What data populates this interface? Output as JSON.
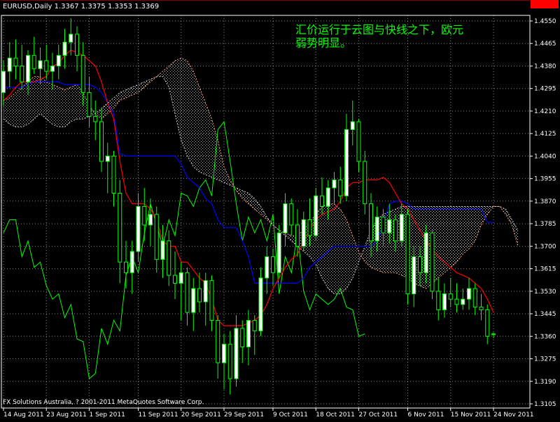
{
  "symbol_header": "EURUSD,Daily  1.3367 1.3375 1.3353 1.3369",
  "annotation": "汇价运行于云图与快线之下，欧元弱势明显。",
  "annotation_lines": [
    "汇价运行于云图与快线之下，欧元",
    "弱势明显。"
  ],
  "copyright": "FX Solutions Australia, ? 2001-2011 MetaQuotes Software Corp.",
  "price_marker": "1.3369",
  "colors": {
    "background": "#000000",
    "grid": "#c0c0c0",
    "candle_outline": "#00ff00",
    "bull_body": "#ffffff",
    "bear_body": "#000000",
    "tenkan": "#ff0000",
    "kijun": "#0000ff",
    "chikou": "#00ff00",
    "cloud_up": "#ffa07a",
    "cloud_down": "#d0d0d0",
    "price_line": "#ff0000",
    "annotation": "#00ff00",
    "text": "#ffffff"
  },
  "chart_data": {
    "type": "candlestick",
    "indicator": "Ichimoku",
    "symbol": "EURUSD",
    "timeframe": "Daily",
    "ohlc_last": {
      "open": 1.3367,
      "high": 1.3375,
      "low": 1.3353,
      "close": 1.3369
    },
    "ylim": [
      1.3105,
      1.455
    ],
    "grid": true,
    "y_ticks": [
      1.455,
      1.4465,
      1.438,
      1.4295,
      1.421,
      1.4125,
      1.404,
      1.3955,
      1.387,
      1.3785,
      1.37,
      1.3615,
      1.353,
      1.3445,
      1.336,
      1.3275,
      1.319,
      1.3105
    ],
    "y_tick_labels": [
      "1.4550",
      "1.4465",
      "1.4380",
      "1.4295",
      "1.4210",
      "1.4125",
      "1.4040",
      "1.3955",
      "1.3870",
      "1.3785",
      "1.3700",
      "1.3615",
      "1.3530",
      "1.3445",
      "1.3360",
      "1.3275",
      "1.3190",
      "1.3105"
    ],
    "x_tick_labels": [
      "14 Aug 2011",
      "23 Aug 2011",
      "1 Sep 2011",
      "11 Sep 2011",
      "20 Sep 2011",
      "29 Sep 2011",
      "9 Oct 2011",
      "18 Oct 2011",
      "27 Oct 2011",
      "6 Nov 2011",
      "15 Nov 2011",
      "24 Nov 2011"
    ],
    "x_tick_bar_index": [
      0,
      7,
      14,
      22,
      29,
      36,
      44,
      51,
      58,
      66,
      73,
      80
    ],
    "bars": [
      {
        "o": 1.428,
        "h": 1.44,
        "l": 1.423,
        "c": 1.436
      },
      {
        "o": 1.436,
        "h": 1.447,
        "l": 1.43,
        "c": 1.441
      },
      {
        "o": 1.441,
        "h": 1.448,
        "l": 1.433,
        "c": 1.438
      },
      {
        "o": 1.438,
        "h": 1.446,
        "l": 1.429,
        "c": 1.432
      },
      {
        "o": 1.432,
        "h": 1.444,
        "l": 1.427,
        "c": 1.442
      },
      {
        "o": 1.442,
        "h": 1.449,
        "l": 1.435,
        "c": 1.437
      },
      {
        "o": 1.437,
        "h": 1.445,
        "l": 1.431,
        "c": 1.44
      },
      {
        "o": 1.44,
        "h": 1.446,
        "l": 1.433,
        "c": 1.436
      },
      {
        "o": 1.436,
        "h": 1.443,
        "l": 1.429,
        "c": 1.438
      },
      {
        "o": 1.438,
        "h": 1.446,
        "l": 1.433,
        "c": 1.442
      },
      {
        "o": 1.442,
        "h": 1.452,
        "l": 1.437,
        "c": 1.447
      },
      {
        "o": 1.447,
        "h": 1.456,
        "l": 1.442,
        "c": 1.45
      },
      {
        "o": 1.45,
        "h": 1.453,
        "l": 1.436,
        "c": 1.442
      },
      {
        "o": 1.442,
        "h": 1.447,
        "l": 1.423,
        "c": 1.428
      },
      {
        "o": 1.428,
        "h": 1.434,
        "l": 1.415,
        "c": 1.419
      },
      {
        "o": 1.419,
        "h": 1.425,
        "l": 1.41,
        "c": 1.417
      },
      {
        "o": 1.417,
        "h": 1.422,
        "l": 1.398,
        "c": 1.402
      },
      {
        "o": 1.402,
        "h": 1.409,
        "l": 1.39,
        "c": 1.404
      },
      {
        "o": 1.404,
        "h": 1.406,
        "l": 1.385,
        "c": 1.39
      },
      {
        "o": 1.39,
        "h": 1.395,
        "l": 1.356,
        "c": 1.364
      },
      {
        "o": 1.364,
        "h": 1.372,
        "l": 1.354,
        "c": 1.36
      },
      {
        "o": 1.36,
        "h": 1.372,
        "l": 1.352,
        "c": 1.368
      },
      {
        "o": 1.368,
        "h": 1.39,
        "l": 1.364,
        "c": 1.385
      },
      {
        "o": 1.385,
        "h": 1.392,
        "l": 1.372,
        "c": 1.378
      },
      {
        "o": 1.378,
        "h": 1.388,
        "l": 1.37,
        "c": 1.382
      },
      {
        "o": 1.382,
        "h": 1.385,
        "l": 1.36,
        "c": 1.365
      },
      {
        "o": 1.365,
        "h": 1.378,
        "l": 1.358,
        "c": 1.372
      },
      {
        "o": 1.372,
        "h": 1.376,
        "l": 1.355,
        "c": 1.359
      },
      {
        "o": 1.359,
        "h": 1.368,
        "l": 1.35,
        "c": 1.356
      },
      {
        "o": 1.356,
        "h": 1.364,
        "l": 1.342,
        "c": 1.36
      },
      {
        "o": 1.36,
        "h": 1.362,
        "l": 1.34,
        "c": 1.345
      },
      {
        "o": 1.345,
        "h": 1.358,
        "l": 1.338,
        "c": 1.354
      },
      {
        "o": 1.354,
        "h": 1.36,
        "l": 1.345,
        "c": 1.349
      },
      {
        "o": 1.349,
        "h": 1.36,
        "l": 1.34,
        "c": 1.357
      },
      {
        "o": 1.357,
        "h": 1.359,
        "l": 1.338,
        "c": 1.342
      },
      {
        "o": 1.342,
        "h": 1.344,
        "l": 1.32,
        "c": 1.326
      },
      {
        "o": 1.326,
        "h": 1.337,
        "l": 1.316,
        "c": 1.333
      },
      {
        "o": 1.333,
        "h": 1.338,
        "l": 1.314,
        "c": 1.32
      },
      {
        "o": 1.32,
        "h": 1.344,
        "l": 1.317,
        "c": 1.339
      },
      {
        "o": 1.339,
        "h": 1.342,
        "l": 1.326,
        "c": 1.332
      },
      {
        "o": 1.332,
        "h": 1.346,
        "l": 1.325,
        "c": 1.342
      },
      {
        "o": 1.342,
        "h": 1.344,
        "l": 1.329,
        "c": 1.338
      },
      {
        "o": 1.338,
        "h": 1.362,
        "l": 1.336,
        "c": 1.358
      },
      {
        "o": 1.358,
        "h": 1.37,
        "l": 1.352,
        "c": 1.366
      },
      {
        "o": 1.366,
        "h": 1.369,
        "l": 1.355,
        "c": 1.36
      },
      {
        "o": 1.36,
        "h": 1.378,
        "l": 1.358,
        "c": 1.375
      },
      {
        "o": 1.375,
        "h": 1.39,
        "l": 1.37,
        "c": 1.386
      },
      {
        "o": 1.386,
        "h": 1.388,
        "l": 1.374,
        "c": 1.378
      },
      {
        "o": 1.378,
        "h": 1.384,
        "l": 1.366,
        "c": 1.37
      },
      {
        "o": 1.37,
        "h": 1.383,
        "l": 1.368,
        "c": 1.38
      },
      {
        "o": 1.38,
        "h": 1.388,
        "l": 1.37,
        "c": 1.374
      },
      {
        "o": 1.374,
        "h": 1.392,
        "l": 1.372,
        "c": 1.389
      },
      {
        "o": 1.389,
        "h": 1.396,
        "l": 1.382,
        "c": 1.385
      },
      {
        "o": 1.385,
        "h": 1.395,
        "l": 1.38,
        "c": 1.392
      },
      {
        "o": 1.392,
        "h": 1.398,
        "l": 1.386,
        "c": 1.395
      },
      {
        "o": 1.395,
        "h": 1.4,
        "l": 1.386,
        "c": 1.389
      },
      {
        "o": 1.389,
        "h": 1.42,
        "l": 1.387,
        "c": 1.414
      },
      {
        "o": 1.414,
        "h": 1.425,
        "l": 1.408,
        "c": 1.417
      },
      {
        "o": 1.417,
        "h": 1.418,
        "l": 1.398,
        "c": 1.402
      },
      {
        "o": 1.402,
        "h": 1.406,
        "l": 1.382,
        "c": 1.386
      },
      {
        "o": 1.386,
        "h": 1.39,
        "l": 1.366,
        "c": 1.372
      },
      {
        "o": 1.372,
        "h": 1.385,
        "l": 1.368,
        "c": 1.381
      },
      {
        "o": 1.381,
        "h": 1.384,
        "l": 1.37,
        "c": 1.375
      },
      {
        "o": 1.375,
        "h": 1.386,
        "l": 1.371,
        "c": 1.38
      },
      {
        "o": 1.38,
        "h": 1.382,
        "l": 1.368,
        "c": 1.372
      },
      {
        "o": 1.372,
        "h": 1.386,
        "l": 1.37,
        "c": 1.382
      },
      {
        "o": 1.382,
        "h": 1.384,
        "l": 1.348,
        "c": 1.352
      },
      {
        "o": 1.352,
        "h": 1.37,
        "l": 1.347,
        "c": 1.366
      },
      {
        "o": 1.366,
        "h": 1.37,
        "l": 1.355,
        "c": 1.36
      },
      {
        "o": 1.36,
        "h": 1.378,
        "l": 1.356,
        "c": 1.375
      },
      {
        "o": 1.375,
        "h": 1.376,
        "l": 1.35,
        "c": 1.353
      },
      {
        "o": 1.353,
        "h": 1.358,
        "l": 1.342,
        "c": 1.346
      },
      {
        "o": 1.346,
        "h": 1.356,
        "l": 1.343,
        "c": 1.352
      },
      {
        "o": 1.352,
        "h": 1.358,
        "l": 1.347,
        "c": 1.35
      },
      {
        "o": 1.35,
        "h": 1.356,
        "l": 1.345,
        "c": 1.348
      },
      {
        "o": 1.348,
        "h": 1.354,
        "l": 1.346,
        "c": 1.35
      },
      {
        "o": 1.35,
        "h": 1.358,
        "l": 1.346,
        "c": 1.354
      },
      {
        "o": 1.354,
        "h": 1.356,
        "l": 1.344,
        "c": 1.347
      },
      {
        "o": 1.347,
        "h": 1.352,
        "l": 1.342,
        "c": 1.346
      },
      {
        "o": 1.346,
        "h": 1.348,
        "l": 1.333,
        "c": 1.336
      },
      {
        "o": 1.3367,
        "h": 1.3375,
        "l": 1.3353,
        "c": 1.3369
      }
    ],
    "tenkan": [
      1.425,
      1.427,
      1.43,
      1.432,
      1.432,
      1.432,
      1.433,
      1.434,
      1.438,
      1.439,
      1.442,
      1.444,
      1.443,
      1.442,
      1.44,
      1.438,
      1.432,
      1.424,
      1.418,
      1.402,
      1.39,
      1.386,
      1.386,
      1.386,
      1.384,
      1.38,
      1.372,
      1.37,
      1.37,
      1.364,
      1.364,
      1.361,
      1.358,
      1.356,
      1.35,
      1.342,
      1.34,
      1.34,
      1.34,
      1.34,
      1.341,
      1.342,
      1.344,
      1.348,
      1.354,
      1.358,
      1.362,
      1.365,
      1.367,
      1.372,
      1.376,
      1.38,
      1.382,
      1.383,
      1.384,
      1.387,
      1.392,
      1.394,
      1.394,
      1.395,
      1.395,
      1.395,
      1.396,
      1.394,
      1.39,
      1.386,
      1.384,
      1.38,
      1.376,
      1.372,
      1.369,
      1.366,
      1.364,
      1.362,
      1.36,
      1.359,
      1.358,
      1.356,
      1.354,
      1.35,
      1.345
    ],
    "kijun": [
      1.43,
      1.43,
      1.43,
      1.43,
      1.431,
      1.432,
      1.432,
      1.432,
      1.432,
      1.432,
      1.431,
      1.431,
      1.431,
      1.431,
      1.431,
      1.43,
      1.428,
      1.424,
      1.42,
      1.405,
      1.404,
      1.404,
      1.404,
      1.404,
      1.404,
      1.404,
      1.404,
      1.404,
      1.404,
      1.401,
      1.396,
      1.394,
      1.392,
      1.388,
      1.386,
      1.38,
      1.377,
      1.377,
      1.377,
      1.372,
      1.366,
      1.356,
      1.356,
      1.356,
      1.356,
      1.356,
      1.356,
      1.356,
      1.356,
      1.358,
      1.362,
      1.364,
      1.366,
      1.368,
      1.37,
      1.37,
      1.37,
      1.37,
      1.37,
      1.37,
      1.37,
      1.372,
      1.378,
      1.386,
      1.387,
      1.387,
      1.386,
      1.384,
      1.384,
      1.384,
      1.384,
      1.384,
      1.384,
      1.384,
      1.384,
      1.384,
      1.384,
      1.384,
      1.384,
      1.379,
      1.379
    ],
    "chikou": [
      1.375,
      1.38,
      1.38,
      1.366,
      1.372,
      1.362,
      1.364,
      1.355,
      1.35,
      1.352,
      1.343,
      1.348,
      1.335,
      1.334,
      1.32,
      1.322,
      1.339,
      1.333,
      1.342,
      1.338,
      1.359,
      1.366,
      1.36,
      1.375,
      1.386,
      1.378,
      1.37,
      1.38,
      1.374,
      1.39,
      1.389,
      1.385,
      1.392,
      1.395,
      1.389,
      1.414,
      1.417,
      1.402,
      1.386,
      1.372,
      1.381,
      1.375,
      1.38,
      1.372,
      1.382,
      1.352,
      1.366,
      1.36,
      1.375,
      1.353,
      1.346,
      1.352,
      1.35,
      1.348,
      1.35,
      1.354,
      1.347,
      1.346,
      1.336,
      1.3369
    ],
    "span_a": [
      1.425,
      1.426,
      1.428,
      1.43,
      1.432,
      1.434,
      1.434,
      1.432,
      1.431,
      1.43,
      1.429,
      1.43,
      1.431,
      1.428,
      1.423,
      1.42,
      1.418,
      1.42,
      1.422,
      1.425,
      1.426,
      1.427,
      1.428,
      1.43,
      1.432,
      1.434,
      1.436,
      1.438,
      1.44,
      1.441,
      1.44,
      1.436,
      1.43,
      1.424,
      1.418,
      1.41,
      1.4,
      1.395,
      1.391,
      1.388,
      1.386,
      1.384,
      1.382,
      1.38,
      1.378,
      1.376,
      1.375,
      1.374,
      1.374,
      1.376,
      1.379,
      1.382,
      1.385,
      1.386,
      1.386,
      1.384,
      1.38,
      1.374,
      1.368,
      1.364,
      1.362,
      1.361,
      1.36,
      1.36,
      1.36,
      1.359,
      1.358,
      1.356,
      1.355,
      1.354,
      1.356,
      1.358,
      1.36,
      1.362,
      1.364,
      1.367,
      1.369,
      1.372,
      1.378,
      1.382,
      1.385,
      1.385,
      1.382,
      1.378,
      1.37
    ],
    "span_b": [
      1.418,
      1.416,
      1.415,
      1.415,
      1.416,
      1.418,
      1.42,
      1.418,
      1.416,
      1.415,
      1.415,
      1.417,
      1.418,
      1.418,
      1.419,
      1.42,
      1.422,
      1.424,
      1.426,
      1.428,
      1.429,
      1.43,
      1.431,
      1.432,
      1.433,
      1.434,
      1.434,
      1.43,
      1.42,
      1.41,
      1.404,
      1.4,
      1.398,
      1.397,
      1.396,
      1.395,
      1.394,
      1.393,
      1.392,
      1.391,
      1.39,
      1.388,
      1.385,
      1.381,
      1.378,
      1.376,
      1.374,
      1.372,
      1.37,
      1.368,
      1.366,
      1.363,
      1.358,
      1.354,
      1.352,
      1.352,
      1.354,
      1.358,
      1.364,
      1.37,
      1.376,
      1.38,
      1.382,
      1.383,
      1.384,
      1.385,
      1.385,
      1.385,
      1.385,
      1.385,
      1.385,
      1.385,
      1.385,
      1.385,
      1.385,
      1.385,
      1.385,
      1.385,
      1.385,
      1.385,
      1.385,
      1.385,
      1.384,
      1.38,
      1.376
    ]
  }
}
